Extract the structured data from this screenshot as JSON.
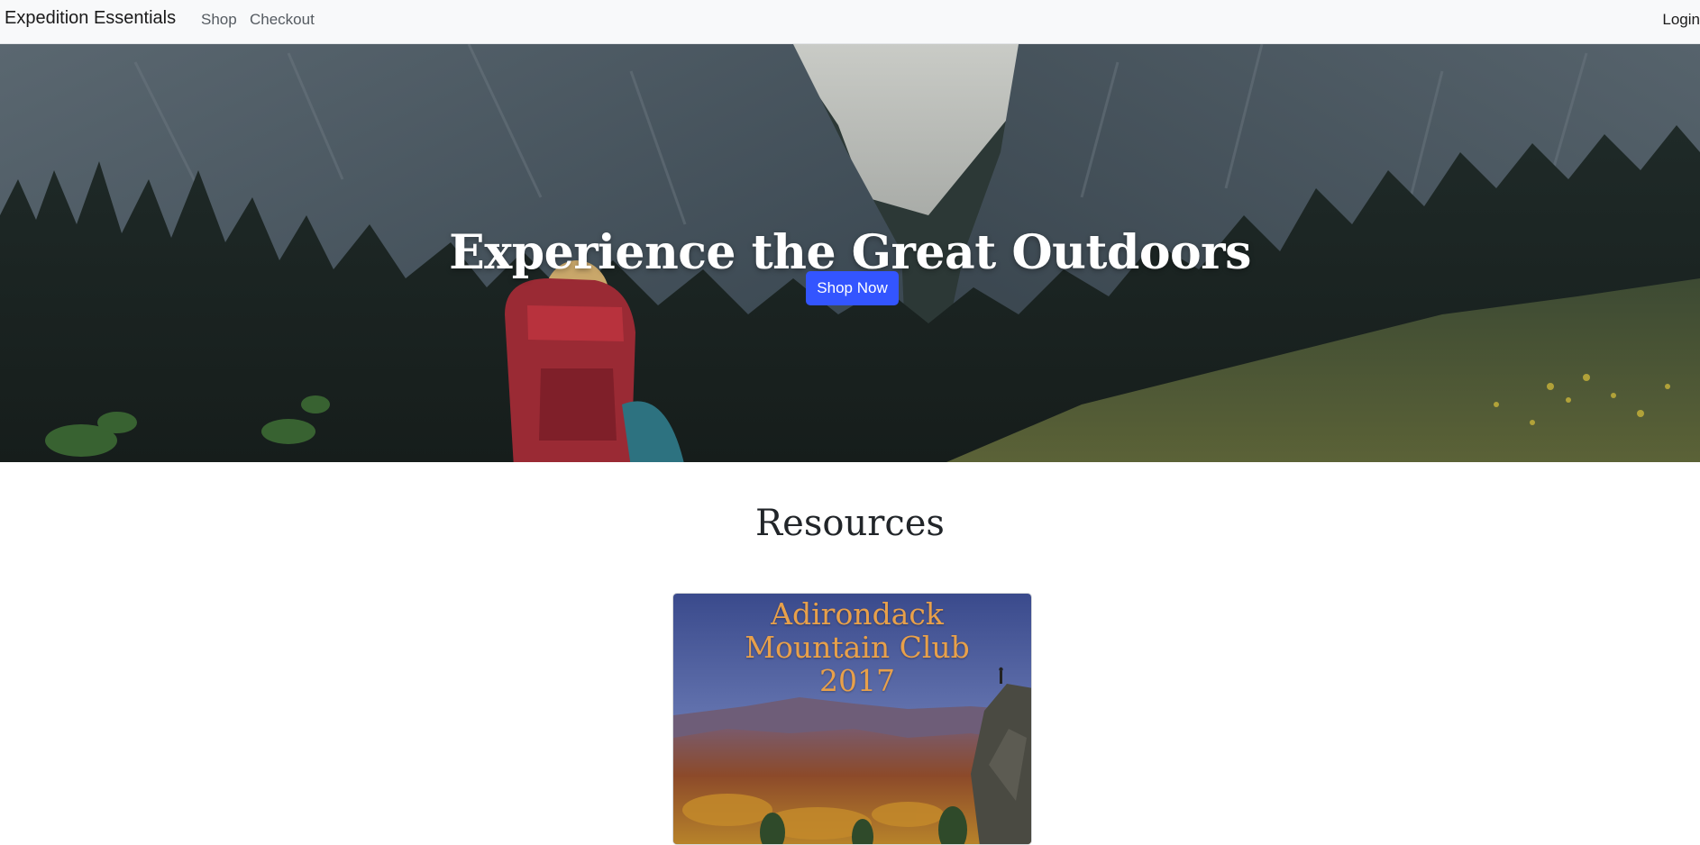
{
  "navbar": {
    "brand": "Expedition Essentials",
    "links": [
      "Shop",
      "Checkout"
    ],
    "login": "Login"
  },
  "hero": {
    "title": "Experience the Great Outdoors",
    "button_label": "Shop Now",
    "accent_color": "#3355ff"
  },
  "resources": {
    "heading": "Resources",
    "cards": [
      {
        "cover_title": "Adirondack\nMountain Club\n2017"
      }
    ]
  }
}
